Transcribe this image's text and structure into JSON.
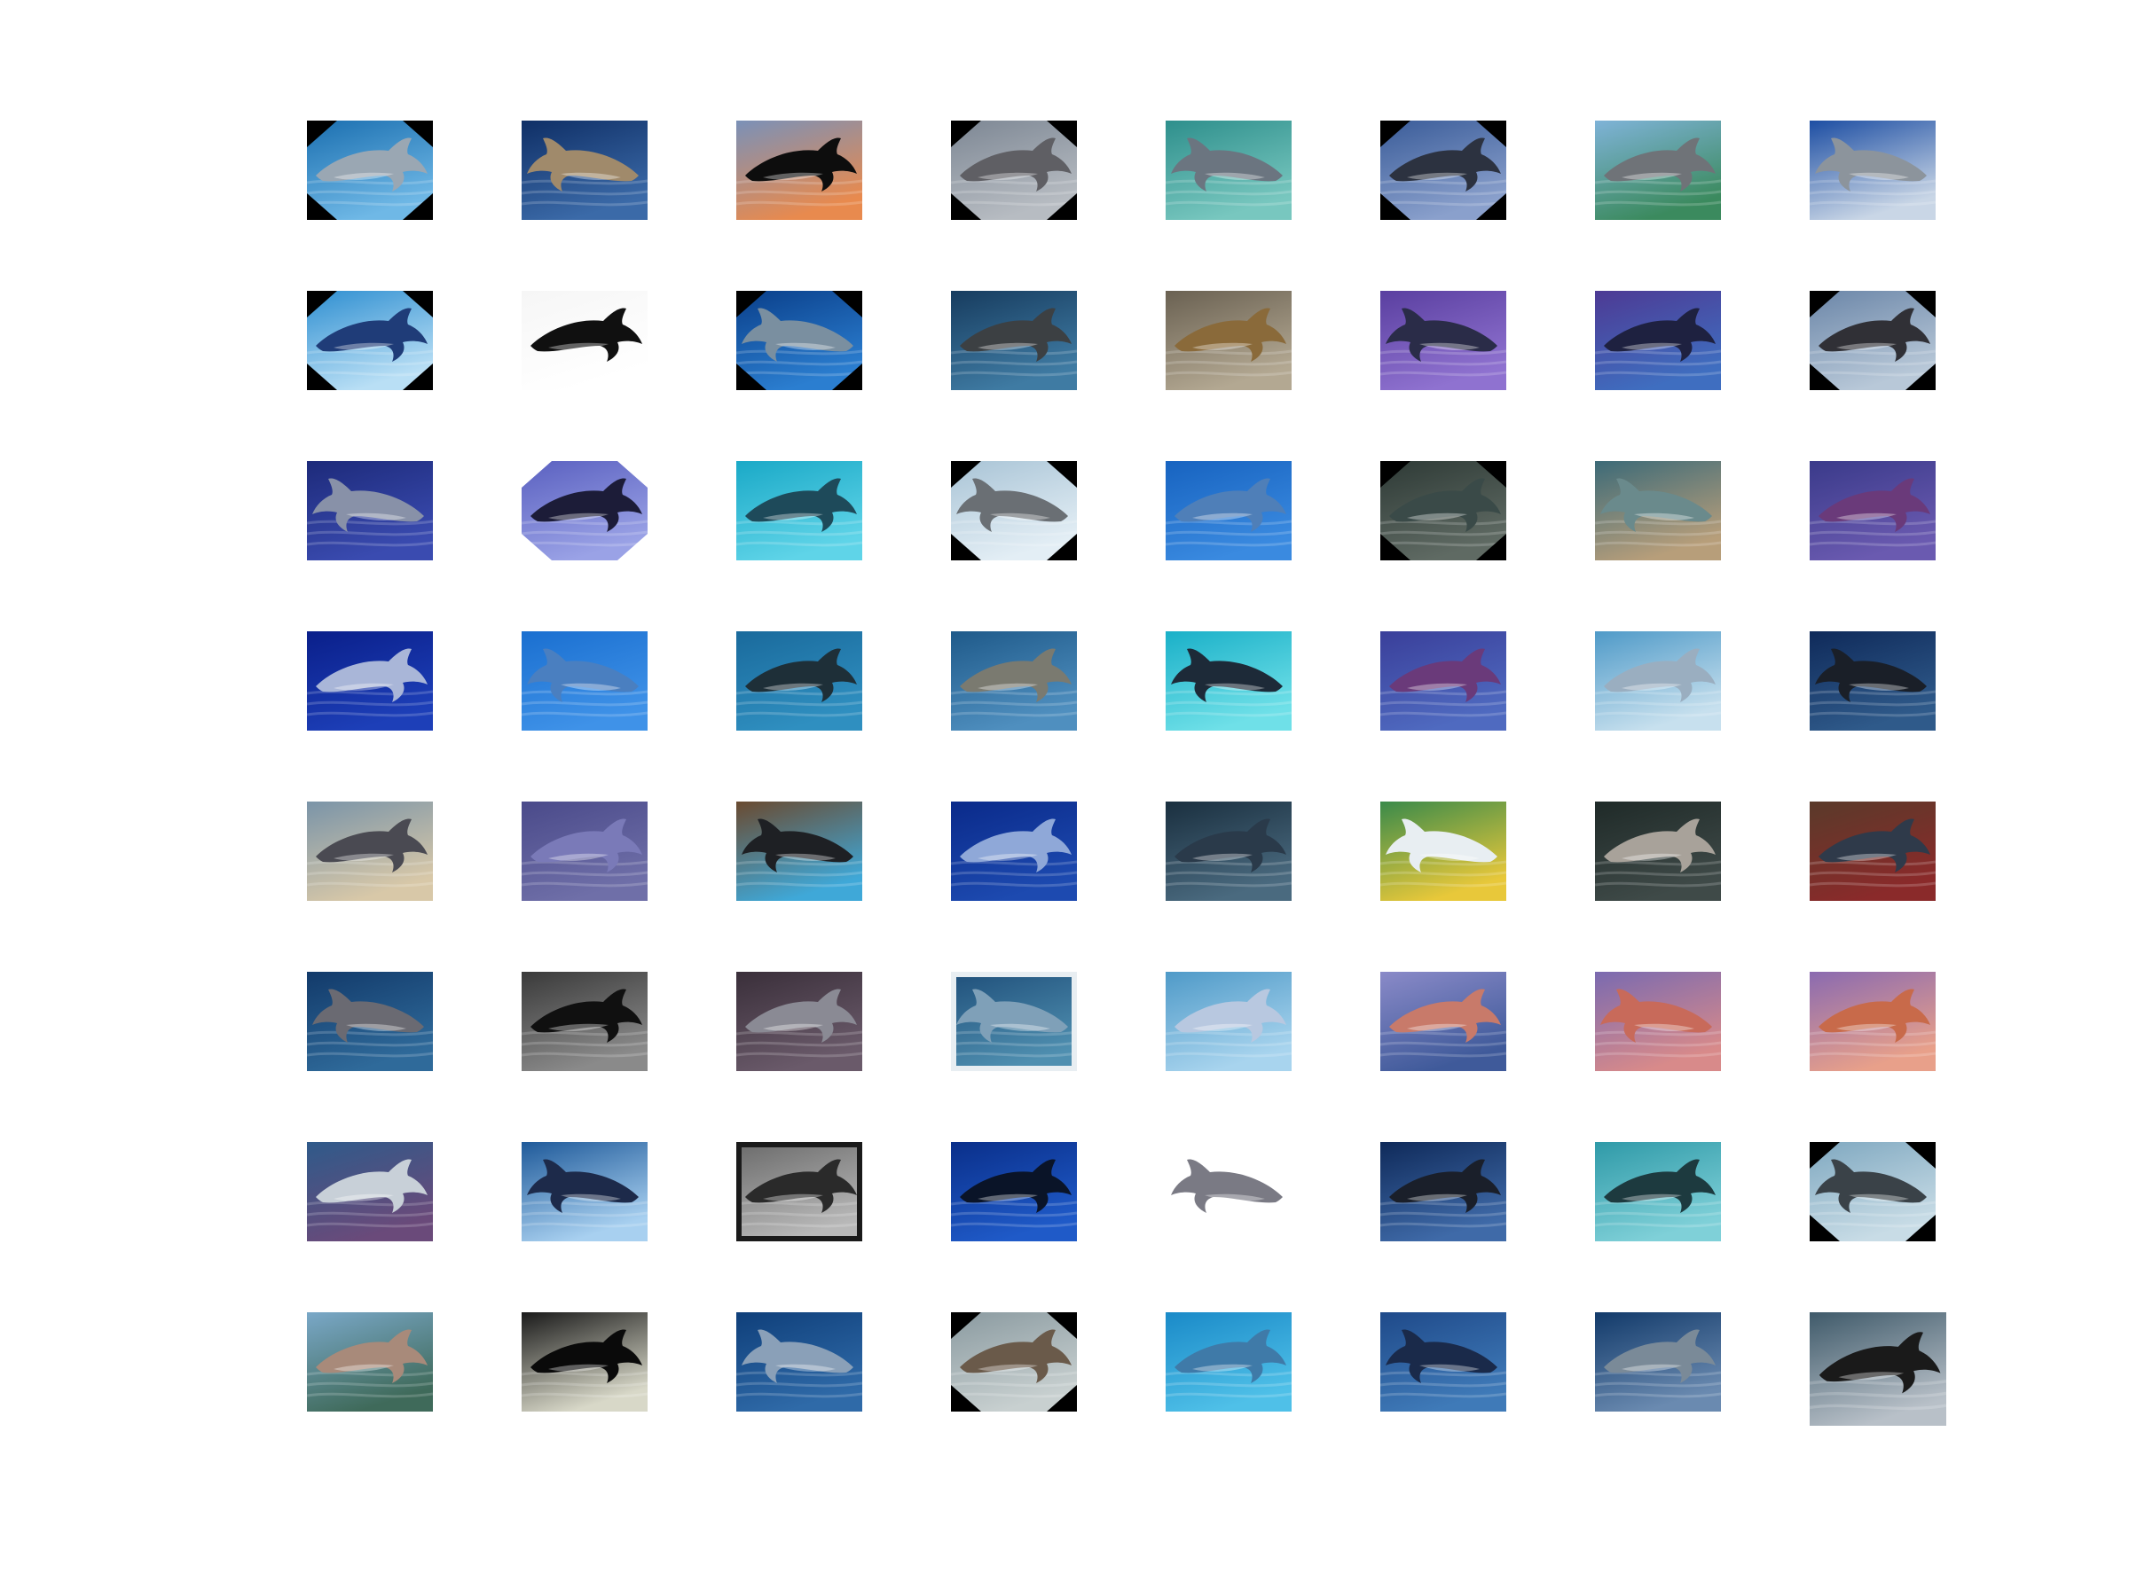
{
  "grid": {
    "rows": 8,
    "cols": 8,
    "thumbnails": [
      {
        "id": "r1c1",
        "bg": [
          "#1b6fb0",
          "#6fb8e6"
        ],
        "dolphin": "#9aa7b3",
        "style": "rotated",
        "matte": "#000000"
      },
      {
        "id": "r1c2",
        "bg": [
          "#0f2f66",
          "#3b6aa8"
        ],
        "dolphin": "#a08a6b",
        "style": "normal"
      },
      {
        "id": "r1c3",
        "bg": [
          "#7a91b8",
          "#e88a4e"
        ],
        "dolphin": "#0d0d0d",
        "style": "normal"
      },
      {
        "id": "r1c4",
        "bg": [
          "#7d8794",
          "#b7bcc2"
        ],
        "dolphin": "#5f5f64",
        "style": "rotated",
        "matte": "#000000"
      },
      {
        "id": "r1c5",
        "bg": [
          "#2e8f8c",
          "#78c7bf"
        ],
        "dolphin": "#6b7580",
        "style": "normal"
      },
      {
        "id": "r1c6",
        "bg": [
          "#3a5c99",
          "#8aa0cc"
        ],
        "dolphin": "#2c3240",
        "style": "rotated",
        "matte": "#000000"
      },
      {
        "id": "r1c7",
        "bg": [
          "#7fb3d8",
          "#3b8a5e"
        ],
        "dolphin": "#6f7378",
        "style": "normal"
      },
      {
        "id": "r1c8",
        "bg": [
          "#1d4ea3",
          "#c9d6e6"
        ],
        "dolphin": "#8c949c",
        "style": "normal"
      },
      {
        "id": "r2c1",
        "bg": [
          "#2f8fd1",
          "#b9dff5"
        ],
        "dolphin": "#1f3c78",
        "style": "rotated",
        "matte": "#000000"
      },
      {
        "id": "r2c2",
        "bg": [
          "#f6f6f6",
          "#ffffff"
        ],
        "dolphin": "#101010",
        "style": "normal"
      },
      {
        "id": "r2c3",
        "bg": [
          "#0a3f8a",
          "#2b7ed0"
        ],
        "dolphin": "#7a8fa0",
        "style": "rotated",
        "matte": "#000000"
      },
      {
        "id": "r2c4",
        "bg": [
          "#173c5f",
          "#3f7ba3"
        ],
        "dolphin": "#3c4043",
        "style": "normal"
      },
      {
        "id": "r2c5",
        "bg": [
          "#6a6152",
          "#b3a892"
        ],
        "dolphin": "#8a6a3a",
        "style": "normal"
      },
      {
        "id": "r2c6",
        "bg": [
          "#5a3fa0",
          "#8f72d0"
        ],
        "dolphin": "#2a2c48",
        "style": "normal"
      },
      {
        "id": "r2c7",
        "bg": [
          "#4d3a94",
          "#3f6ec0"
        ],
        "dolphin": "#1e2140",
        "style": "normal"
      },
      {
        "id": "r2c8",
        "bg": [
          "#6b86a8",
          "#b8c8d8"
        ],
        "dolphin": "#303036",
        "style": "rotated",
        "matte": "#000000"
      },
      {
        "id": "r3c1",
        "bg": [
          "#1d2a7a",
          "#3a4bb0"
        ],
        "dolphin": "#8891a8",
        "style": "normal"
      },
      {
        "id": "r3c2",
        "bg": [
          "#5a60c0",
          "#9aa2e6"
        ],
        "dolphin": "#1c1c38",
        "style": "rotated",
        "matte": "#ffffff"
      },
      {
        "id": "r3c3",
        "bg": [
          "#1aa9c7",
          "#5fd4e8"
        ],
        "dolphin": "#1e4a5a",
        "style": "normal"
      },
      {
        "id": "r3c4",
        "bg": [
          "#a9c4d6",
          "#e3eef5"
        ],
        "dolphin": "#6a6f74",
        "style": "rotated",
        "matte": "#000000"
      },
      {
        "id": "r3c5",
        "bg": [
          "#1763c0",
          "#3a8ae0"
        ],
        "dolphin": "#4f7fb8",
        "style": "normal"
      },
      {
        "id": "r3c6",
        "bg": [
          "#2e3a36",
          "#5f6a63"
        ],
        "dolphin": "#3a4a48",
        "style": "rotated",
        "matte": "#000000"
      },
      {
        "id": "r3c7",
        "bg": [
          "#3c6a78",
          "#b79e7a"
        ],
        "dolphin": "#6a8a8c",
        "style": "normal"
      },
      {
        "id": "r3c8",
        "bg": [
          "#3a3a8a",
          "#6a5ab0"
        ],
        "dolphin": "#6a3a7a",
        "style": "normal"
      },
      {
        "id": "r4c1",
        "bg": [
          "#0a1f8a",
          "#1d3fb8"
        ],
        "dolphin": "#a9b6d8",
        "style": "normal"
      },
      {
        "id": "r4c2",
        "bg": [
          "#1a6fd0",
          "#3f92e8"
        ],
        "dolphin": "#4a7fc0",
        "style": "normal"
      },
      {
        "id": "r4c3",
        "bg": [
          "#1a6a9c",
          "#2f8fc0"
        ],
        "dolphin": "#1e2f38",
        "style": "normal"
      },
      {
        "id": "r4c4",
        "bg": [
          "#1f5a8a",
          "#4f8fbf"
        ],
        "dolphin": "#7a7a70",
        "style": "normal"
      },
      {
        "id": "r4c5",
        "bg": [
          "#1ab0c8",
          "#6fe0e8"
        ],
        "dolphin": "#1d2a38",
        "style": "normal"
      },
      {
        "id": "r4c6",
        "bg": [
          "#3a3f9a",
          "#4f6ac0"
        ],
        "dolphin": "#6a3a7a",
        "style": "normal"
      },
      {
        "id": "r4c7",
        "bg": [
          "#4f9ac8",
          "#c7e0ee"
        ],
        "dolphin": "#9aaec0",
        "style": "normal"
      },
      {
        "id": "r4c8",
        "bg": [
          "#0f2a5a",
          "#2f5a8a"
        ],
        "dolphin": "#1a1f28",
        "style": "normal"
      },
      {
        "id": "r5c1",
        "bg": [
          "#7a94a8",
          "#d8c8a8"
        ],
        "dolphin": "#4a4a52",
        "style": "normal"
      },
      {
        "id": "r5c2",
        "bg": [
          "#4a4a8a",
          "#6f6fa8"
        ],
        "dolphin": "#7a7ab8",
        "style": "normal"
      },
      {
        "id": "r5c3",
        "bg": [
          "#6a4a30",
          "#3fa8d8"
        ],
        "dolphin": "#1e2024",
        "style": "normal"
      },
      {
        "id": "r5c4",
        "bg": [
          "#0a2a8a",
          "#1d4ab0"
        ],
        "dolphin": "#8fa8d8",
        "style": "normal"
      },
      {
        "id": "r5c5",
        "bg": [
          "#1a2f3f",
          "#4a6a7f"
        ],
        "dolphin": "#2a3a4a",
        "style": "normal"
      },
      {
        "id": "r5c6",
        "bg": [
          "#3a8a4a",
          "#e8c83a"
        ],
        "dolphin": "#e8eef2",
        "style": "normal"
      },
      {
        "id": "r5c7",
        "bg": [
          "#1f2a28",
          "#3f4a48"
        ],
        "dolphin": "#a8a29a",
        "style": "normal"
      },
      {
        "id": "r5c8",
        "bg": [
          "#5a3a2a",
          "#8a2a2a"
        ],
        "dolphin": "#2f3a4a",
        "style": "normal"
      },
      {
        "id": "r6c1",
        "bg": [
          "#123a6a",
          "#2f6a9a"
        ],
        "dolphin": "#6a6a72",
        "style": "normal"
      },
      {
        "id": "r6c2",
        "bg": [
          "#3a3a3a",
          "#8a8a8a"
        ],
        "dolphin": "#101010",
        "style": "normal"
      },
      {
        "id": "r6c3",
        "bg": [
          "#3a2f3a",
          "#6a5a6a"
        ],
        "dolphin": "#8a8a94",
        "style": "normal"
      },
      {
        "id": "r6c4",
        "bg": [
          "#1f4f7a",
          "#4f8fb0"
        ],
        "dolphin": "#7fa0b8",
        "style": "framed",
        "matte": "#e8eef2"
      },
      {
        "id": "r6c5",
        "bg": [
          "#4f9ac8",
          "#a8d4ee"
        ],
        "dolphin": "#b8c8e0",
        "style": "normal"
      },
      {
        "id": "r6c6",
        "bg": [
          "#8a8ac8",
          "#3f5a9a"
        ],
        "dolphin": "#c87a6a",
        "style": "normal"
      },
      {
        "id": "r6c7",
        "bg": [
          "#7a6ab0",
          "#d88a8a"
        ],
        "dolphin": "#c86a5a",
        "style": "normal"
      },
      {
        "id": "r6c8",
        "bg": [
          "#8a6ab0",
          "#e8a08a"
        ],
        "dolphin": "#c86a4a",
        "style": "normal"
      },
      {
        "id": "r7c1",
        "bg": [
          "#2f5a8a",
          "#6a4a7a"
        ],
        "dolphin": "#c8d0d8",
        "style": "normal"
      },
      {
        "id": "r7c2",
        "bg": [
          "#1f5a9a",
          "#a8d0f0"
        ],
        "dolphin": "#1d2a4a",
        "style": "normal"
      },
      {
        "id": "r7c3",
        "bg": [
          "#6a6a6a",
          "#b8b8b8"
        ],
        "dolphin": "#2a2a2a",
        "style": "framed",
        "matte": "#1a1a1a"
      },
      {
        "id": "r7c4",
        "bg": [
          "#0a2f8a",
          "#1f5ac8"
        ],
        "dolphin": "#0a1428",
        "style": "normal"
      },
      {
        "id": "r7c5",
        "bg": [
          "#ffffff",
          "#ffffff"
        ],
        "dolphin": "#7a7a84",
        "style": "normal"
      },
      {
        "id": "r7c6",
        "bg": [
          "#0f2a5a",
          "#3f6aa8"
        ],
        "dolphin": "#1a1f2a",
        "style": "normal"
      },
      {
        "id": "r7c7",
        "bg": [
          "#2f9aa8",
          "#7fd0d8"
        ],
        "dolphin": "#1d3a3f",
        "style": "normal"
      },
      {
        "id": "r7c8",
        "bg": [
          "#7fa8c0",
          "#c8dce6"
        ],
        "dolphin": "#3a4248",
        "style": "rotated",
        "matte": "#000000"
      },
      {
        "id": "r8c1",
        "bg": [
          "#7aa8c8",
          "#3f6a5a"
        ],
        "dolphin": "#a88a7a",
        "style": "normal"
      },
      {
        "id": "r8c2",
        "bg": [
          "#1a1a1a",
          "#d8d8c8"
        ],
        "dolphin": "#0a0a0a",
        "style": "normal"
      },
      {
        "id": "r8c3",
        "bg": [
          "#0f3f7a",
          "#2f6aa8"
        ],
        "dolphin": "#8aa0b8",
        "style": "normal"
      },
      {
        "id": "r8c4",
        "bg": [
          "#8a9aa0",
          "#c8d0d0"
        ],
        "dolphin": "#6a5a4a",
        "style": "rotated",
        "matte": "#000000"
      },
      {
        "id": "r8c5",
        "bg": [
          "#1a8ac8",
          "#4fc0e8"
        ],
        "dolphin": "#3f7aa8",
        "style": "normal"
      },
      {
        "id": "r8c6",
        "bg": [
          "#1f4a8a",
          "#3f7ab8"
        ],
        "dolphin": "#1a2a4a",
        "style": "normal"
      },
      {
        "id": "r8c7",
        "bg": [
          "#123a6a",
          "#6a8ab0"
        ],
        "dolphin": "#7a8a98",
        "style": "normal"
      },
      {
        "id": "r8c8",
        "bg": [
          "#3f5a6a",
          "#b8c0c8"
        ],
        "dolphin": "#1a1a1a",
        "style": "normal"
      }
    ]
  }
}
